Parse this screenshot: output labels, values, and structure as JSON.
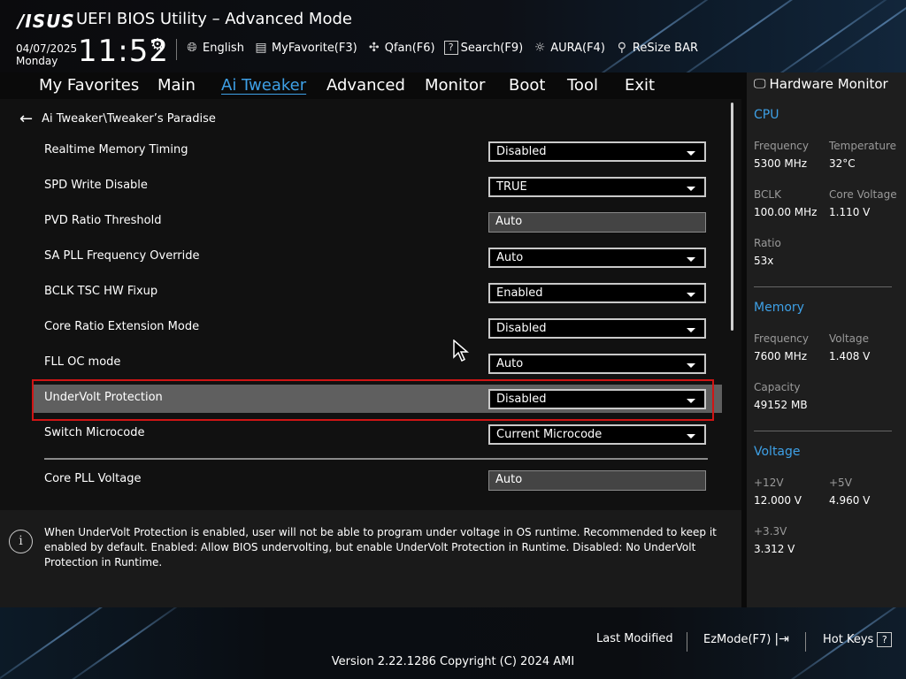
{
  "header": {
    "logo": "/ISUS",
    "title": "UEFI BIOS Utility – Advanced Mode",
    "date": "04/07/2025",
    "day": "Monday",
    "time": "11:52",
    "tools": [
      {
        "icon": "globe-icon",
        "label": "English"
      },
      {
        "icon": "favorite-icon",
        "label": "MyFavorite(F3)"
      },
      {
        "icon": "fan-icon",
        "label": "Qfan(F6)"
      },
      {
        "icon": "search-help-icon",
        "label": "Search(F9)"
      },
      {
        "icon": "aura-icon",
        "label": "AURA(F4)"
      },
      {
        "icon": "resize-bar-icon",
        "label": "ReSize BAR"
      }
    ]
  },
  "nav": {
    "tabs": [
      "My Favorites",
      "Main",
      "Ai Tweaker",
      "Advanced",
      "Monitor",
      "Boot",
      "Tool",
      "Exit"
    ],
    "active": "Ai Tweaker"
  },
  "breadcrumb": "Ai Tweaker\\Tweaker’s Paradise",
  "settings": [
    {
      "label": "Realtime Memory Timing",
      "value": "Disabled"
    },
    {
      "label": "SPD Write Disable",
      "value": "TRUE"
    },
    {
      "label": "PVD Ratio Threshold",
      "value": "Auto"
    },
    {
      "label": "SA PLL Frequency Override",
      "value": "Auto"
    },
    {
      "label": "BCLK TSC HW Fixup",
      "value": "Enabled"
    },
    {
      "label": "Core Ratio Extension Mode",
      "value": "Disabled"
    },
    {
      "label": "FLL OC mode",
      "value": "Auto"
    },
    {
      "label": "UnderVolt Protection",
      "value": "Disabled"
    },
    {
      "label": "Switch Microcode",
      "value": "Current Microcode"
    },
    {
      "label": "Core PLL Voltage",
      "value": "Auto"
    }
  ],
  "help_text": "When UnderVolt Protection is enabled, user will not be able to program under voltage in OS runtime. Recommended to keep it enabled by default. Enabled: Allow BIOS undervolting, but enable UnderVolt Protection in Runtime. Disabled: No UnderVolt Protection in Runtime.",
  "hardware_monitor": {
    "title": "Hardware Monitor",
    "cpu": {
      "title": "CPU",
      "frequency_label": "Frequency",
      "frequency": "5300 MHz",
      "temperature_label": "Temperature",
      "temperature": "32°C",
      "bclk_label": "BCLK",
      "bclk": "100.00 MHz",
      "core_voltage_label": "Core Voltage",
      "core_voltage": "1.110 V",
      "ratio_label": "Ratio",
      "ratio": "53x"
    },
    "memory": {
      "title": "Memory",
      "frequency_label": "Frequency",
      "frequency": "7600 MHz",
      "voltage_label": "Voltage",
      "voltage": "1.408 V",
      "capacity_label": "Capacity",
      "capacity": "49152 MB"
    },
    "voltage": {
      "title": "Voltage",
      "v12_label": "+12V",
      "v12": "12.000 V",
      "v5_label": "+5V",
      "v5": "4.960 V",
      "v33_label": "+3.3V",
      "v33": "3.312 V"
    }
  },
  "footer": {
    "last_modified": "Last Modified",
    "ezmode": "EzMode(F7)",
    "hotkeys": "Hot Keys",
    "hotkeys_box": "?",
    "version": "Version 2.22.1286 Copyright (C) 2024 AMI"
  }
}
